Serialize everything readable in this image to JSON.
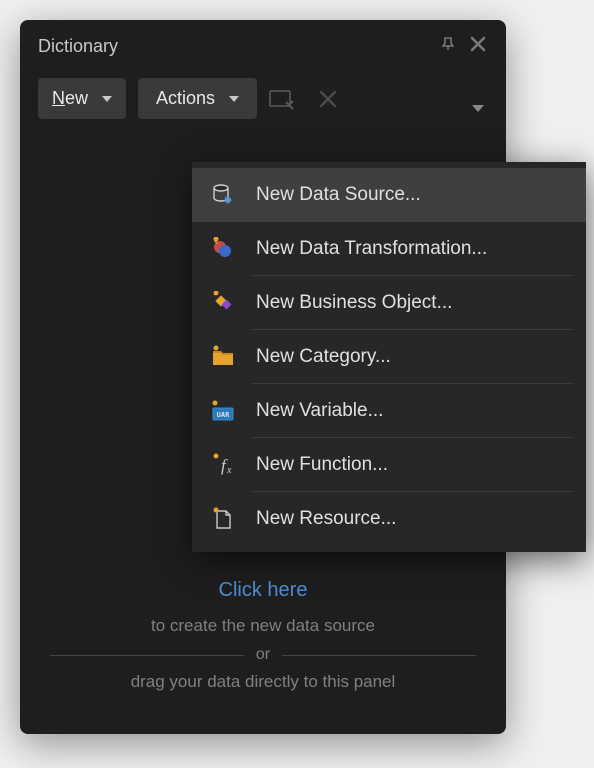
{
  "panel": {
    "title": "Dictionary"
  },
  "toolbar": {
    "new_label": "New",
    "actions_label": "Actions"
  },
  "menu": {
    "items": [
      {
        "label": "New Data Source...",
        "icon": "data-source",
        "highlighted": true
      },
      {
        "label": "New Data Transformation...",
        "icon": "data-transformation",
        "highlighted": false
      },
      {
        "label": "New Business Object...",
        "icon": "business-object",
        "highlighted": false
      },
      {
        "label": "New Category...",
        "icon": "category",
        "highlighted": false
      },
      {
        "label": "New Variable...",
        "icon": "variable",
        "highlighted": false
      },
      {
        "label": "New Function...",
        "icon": "function",
        "highlighted": false
      },
      {
        "label": "New Resource...",
        "icon": "resource",
        "highlighted": false
      }
    ]
  },
  "empty_state": {
    "click_here": "Click here",
    "hint1": "to create the new data source",
    "or": "or",
    "hint2": "drag your data directly to this panel"
  }
}
